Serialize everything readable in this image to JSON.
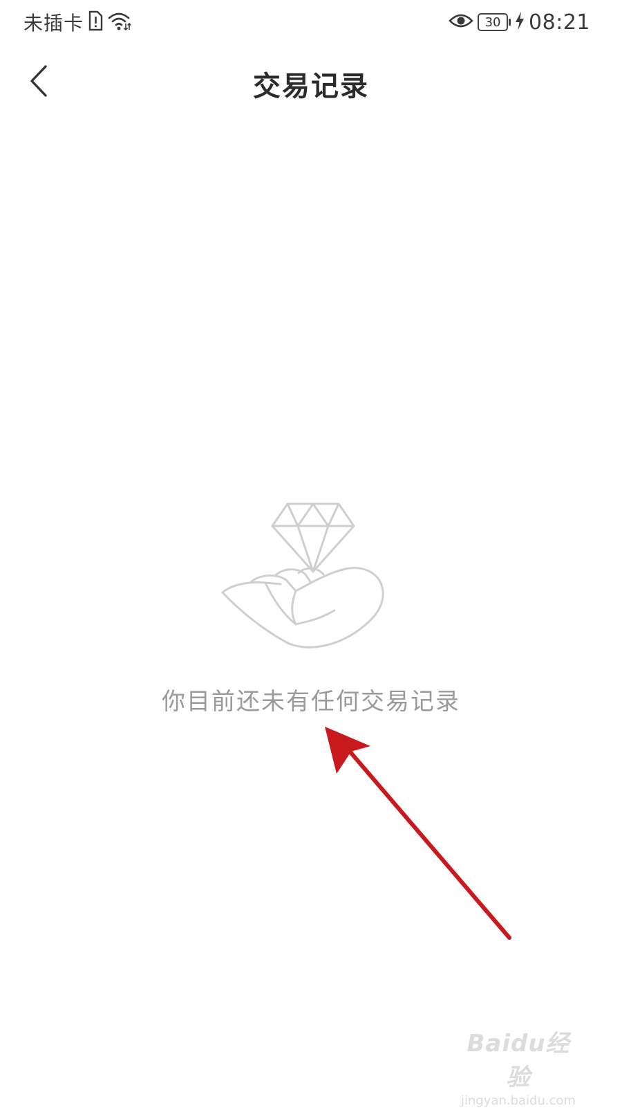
{
  "status_bar": {
    "carrier": "未插卡",
    "battery_level": "30",
    "time": "08:21",
    "icons": [
      "sim-alert-icon",
      "wifi-icon",
      "eye-icon",
      "battery-icon",
      "charging-icon"
    ]
  },
  "nav": {
    "title": "交易记录",
    "back_icon": "chevron-left-icon"
  },
  "empty_state": {
    "illustration": "hand-holding-diamond-icon",
    "message": "你目前还未有任何交易记录"
  },
  "annotation": {
    "arrow_color": "#c8191e"
  },
  "watermark": {
    "brand": "Baidu经验",
    "domain": "jingyan.baidu.com"
  },
  "colors": {
    "background": "#ffffff",
    "title": "#2b2b2b",
    "empty_text": "#9a9a9a",
    "illustration_stroke": "#cfcfcf",
    "arrow": "#c8191e"
  }
}
